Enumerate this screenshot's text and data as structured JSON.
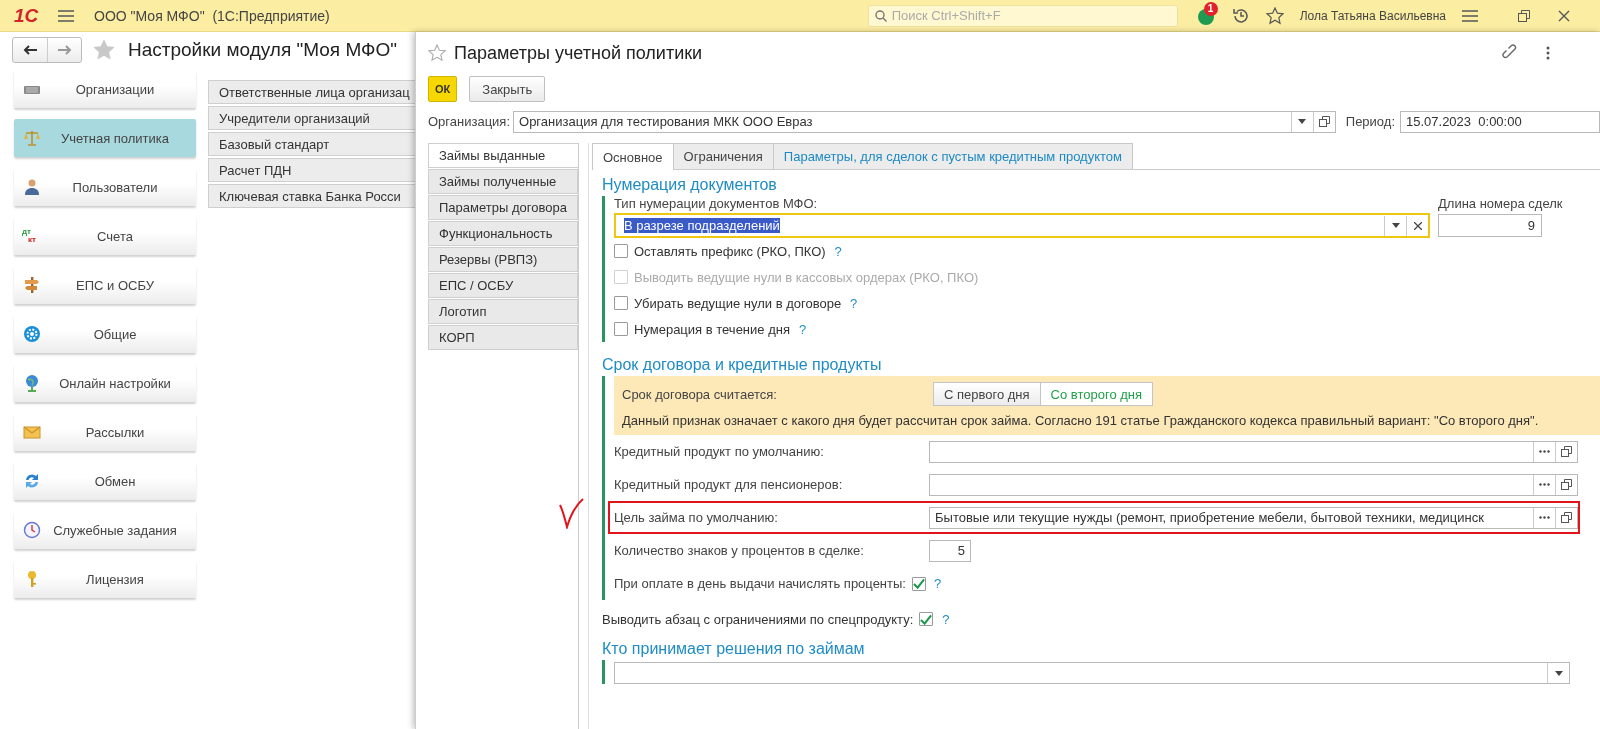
{
  "app_bar": {
    "logo": "1С",
    "title": "ООО \"Моя МФО\"  (1С:Предприятие)",
    "search": {
      "placeholder": "Поиск Ctrl+Shift+F"
    },
    "notification_count": "1",
    "user": "Лола Татьяна Васильевна"
  },
  "page": {
    "title": "Настройки модуля \"Моя МФО\"",
    "nav": [
      {
        "label": "Организации",
        "selected": false
      },
      {
        "label": "Учетная политика",
        "selected": true
      },
      {
        "label": "Пользователи",
        "selected": false
      },
      {
        "label": "Счета",
        "selected": false,
        "icon_text": [
          "дт",
          "кт"
        ]
      },
      {
        "label": "ЕПС и ОСБУ",
        "selected": false
      },
      {
        "label": "Общие",
        "selected": false
      },
      {
        "label": "Онлайн настройки",
        "selected": false
      },
      {
        "label": "Рассылки",
        "selected": false
      },
      {
        "label": "Обмен",
        "selected": false
      },
      {
        "label": "Служебные задания",
        "selected": false
      },
      {
        "label": "Лицензия",
        "selected": false
      }
    ],
    "sub_items": [
      "Ответственные лица организац",
      "Учредители организаций",
      "Базовый стандарт",
      "Расчет ПДН",
      "Ключевая ставка Банка Росси"
    ]
  },
  "dialog": {
    "title": "Параметры учетной политики",
    "buttons": [
      {
        "label": "ОК",
        "kind": "default"
      },
      {
        "label": "Закрыть",
        "kind": "plain"
      }
    ],
    "organization": {
      "label": "Организация:",
      "value": "Организация для тестирования МКК ООО Евраз"
    },
    "period": {
      "label": "Период:",
      "value": "15.07.2023  0:00:00"
    },
    "side_tabs": [
      {
        "label": "Займы выданные",
        "selected": true
      },
      {
        "label": "Займы полученные",
        "selected": false
      },
      {
        "label": "Параметры договора",
        "selected": false
      },
      {
        "label": "Функциональность",
        "selected": false
      },
      {
        "label": "Резервы (РВПЗ)",
        "selected": false
      },
      {
        "label": "ЕПС / ОСБУ",
        "selected": false
      },
      {
        "label": "Логотип",
        "selected": false
      },
      {
        "label": "КОРП",
        "selected": false
      }
    ],
    "tabs": [
      {
        "label": "Основное",
        "selected": true,
        "kind": "plain"
      },
      {
        "label": "Ограничения",
        "selected": false,
        "kind": "plain"
      },
      {
        "label": "Параметры, для сделок с пустым кредитным продуктом",
        "selected": false,
        "kind": "link"
      }
    ],
    "numbering": {
      "heading": "Нумерация документов",
      "type_label": "Тип нумерации документов МФО:",
      "type_value": "В разрезе подразделений",
      "length_label": "Длина номера сделк",
      "length_value": "9",
      "options": [
        {
          "label": "Оставлять префикс (РКО, ПКО)",
          "checked": false,
          "disabled": false,
          "help": "?"
        },
        {
          "label": "Выводить ведущие нули в кассовых ордерах (РКО, ПКО)",
          "checked": false,
          "disabled": true
        },
        {
          "label": "Убирать ведущие нули в договоре",
          "checked": false,
          "disabled": false,
          "help": "?"
        },
        {
          "label": "Нумерация в течение дня",
          "checked": false,
          "disabled": false,
          "help": "?"
        }
      ]
    },
    "term": {
      "heading": "Срок договора и кредитные продукты",
      "count_label": "Срок договора считается:",
      "choices": [
        {
          "label": "С первого дня",
          "selected": false
        },
        {
          "label": "Со второго дня",
          "selected": true
        }
      ],
      "note": "Данный признак означает с какого дня будет рассчитан срок займа. Согласно 191 статье Гражданского кодекса правильный вариант: \"Со второго дня\".",
      "fields": [
        {
          "kind": "reference",
          "label": "Кредитный продукт по умолчанию:",
          "marked": false
        },
        {
          "kind": "reference",
          "label": "Кредитный продукт для пенсионеров:",
          "marked": false
        },
        {
          "kind": "reference",
          "label": "Цель займа по умолчанию:",
          "value": "Бытовые или текущие нужды (ремонт, приобретение мебели, бытовой техники, медицинск",
          "marked": true
        },
        {
          "kind": "number",
          "label": "Количество знаков у процентов в сделке:",
          "value": "5",
          "marked": false
        },
        {
          "kind": "checkbox",
          "label": "При оплате в день выдачи начислять проценты:",
          "checked": true,
          "help": "?",
          "marked": false
        }
      ]
    },
    "restrictions": {
      "label": "Выводить абзац с ограничениями по спецпродукту:",
      "checked": true,
      "help": "?"
    },
    "decisions": {
      "heading": "Кто принимает решения по займам"
    }
  }
}
